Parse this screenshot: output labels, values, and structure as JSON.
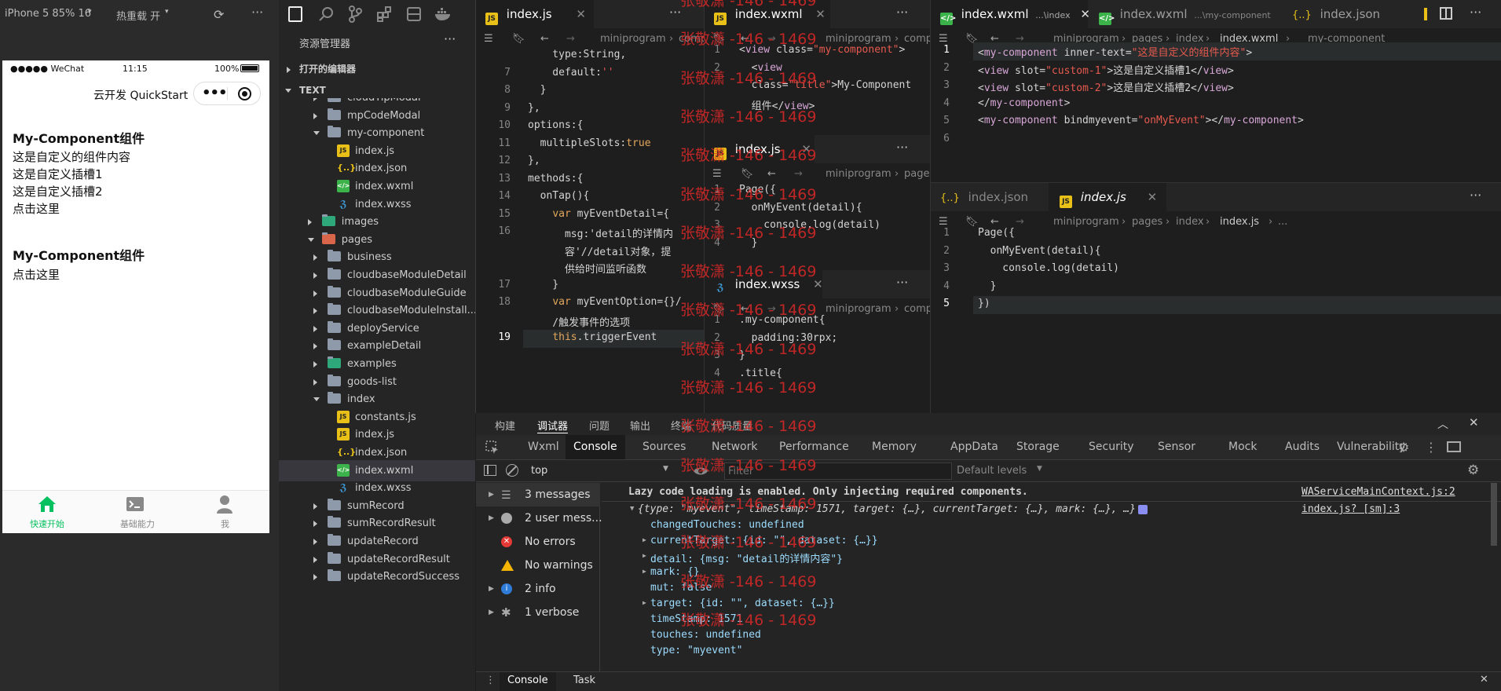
{
  "simulator": {
    "device": "iPhone 5 85% 16",
    "hot_reload": "热重载 开",
    "status_left": "●●●●● WeChat",
    "time": "11:15",
    "battery": "100%",
    "nav_title": "云开发 QuickStart",
    "content": [
      "My-Component组件",
      "这是自定义的组件内容",
      "这是自定义插槽1",
      "这是自定义插槽2",
      "点击这里",
      "My-Component组件",
      "点击这里"
    ],
    "tabbar": [
      "快速开始",
      "基础能力",
      "我"
    ]
  },
  "explorer": {
    "title": "资源管理器",
    "open_editors": "打开的编辑器",
    "root": "TEXT",
    "items": [
      {
        "label": "cloudTipModal",
        "type": "folder"
      },
      {
        "label": "mpCodeModal",
        "type": "folder"
      },
      {
        "label": "my-component",
        "type": "folder-open"
      },
      {
        "label": "index.js",
        "type": "js"
      },
      {
        "label": "index.json",
        "type": "json"
      },
      {
        "label": "index.wxml",
        "type": "wxml"
      },
      {
        "label": "index.wxss",
        "type": "wxss"
      },
      {
        "label": "images",
        "type": "folder"
      },
      {
        "label": "pages",
        "type": "folder-open"
      },
      {
        "label": "business",
        "type": "folder"
      },
      {
        "label": "cloudbaseModuleDetail",
        "type": "folder"
      },
      {
        "label": "cloudbaseModuleGuide",
        "type": "folder"
      },
      {
        "label": "cloudbaseModuleInstall...",
        "type": "folder"
      },
      {
        "label": "deployService",
        "type": "folder"
      },
      {
        "label": "exampleDetail",
        "type": "folder"
      },
      {
        "label": "examples",
        "type": "folder"
      },
      {
        "label": "goods-list",
        "type": "folder"
      },
      {
        "label": "index",
        "type": "folder-open"
      },
      {
        "label": "constants.js",
        "type": "js"
      },
      {
        "label": "index.js",
        "type": "js"
      },
      {
        "label": "index.json",
        "type": "json"
      },
      {
        "label": "index.wxml",
        "type": "wxml"
      },
      {
        "label": "index.wxss",
        "type": "wxss"
      },
      {
        "label": "sumRecord",
        "type": "folder"
      },
      {
        "label": "sumRecordResult",
        "type": "folder"
      },
      {
        "label": "updateRecord",
        "type": "folder"
      },
      {
        "label": "updateRecordResult",
        "type": "folder"
      },
      {
        "label": "updateRecordSuccess",
        "type": "folder"
      }
    ]
  },
  "editor1": {
    "tab": "index.js",
    "breadcrumb": [
      "miniprogram",
      "comp"
    ],
    "lines": [
      {
        "n": "",
        "t": "    type:String,"
      },
      {
        "n": "7",
        "t": "    default:''"
      },
      {
        "n": "8",
        "t": "  }"
      },
      {
        "n": "9",
        "t": "},"
      },
      {
        "n": "10",
        "t": "options:{"
      },
      {
        "n": "11",
        "t": "  multipleSlots:true"
      },
      {
        "n": "12",
        "t": "},"
      },
      {
        "n": "13",
        "t": "methods:{"
      },
      {
        "n": "14",
        "t": "  onTap(){"
      },
      {
        "n": "15",
        "t": "    var myEventDetail={"
      },
      {
        "n": "16",
        "t": "      msg:'detail的详情内"
      },
      {
        "n": "",
        "t": "      容'//detail对象，提"
      },
      {
        "n": "",
        "t": "      供给时间监听函数"
      },
      {
        "n": "17",
        "t": "    }"
      },
      {
        "n": "18",
        "t": "    var myEventOption={}/"
      },
      {
        "n": "",
        "t": "    /触发事件的选项"
      },
      {
        "n": "19",
        "t": "    this.triggerEvent"
      }
    ]
  },
  "editor2": {
    "tab": "index.wxml",
    "breadcrumb": [
      "miniprogram",
      "comp"
    ],
    "lines": [
      {
        "n": "1",
        "t": "<view class=\"my-component\">"
      },
      {
        "n": "2",
        "t": "  <view"
      },
      {
        "n": "",
        "t": "  class=\"title\">My-Component"
      },
      {
        "n": "",
        "t": "  组件</view>"
      }
    ]
  },
  "editor3": {
    "tab": "index.js",
    "breadcrumb": [
      "miniprogram",
      "pages"
    ],
    "lines": [
      {
        "n": "1",
        "t": "Page({"
      },
      {
        "n": "2",
        "t": "  onMyEvent(detail){"
      },
      {
        "n": "3",
        "t": "    console.log(detail)"
      },
      {
        "n": "4",
        "t": "  }"
      }
    ]
  },
  "editor4": {
    "tab": "index.wxss",
    "breadcrumb": [
      "miniprogram",
      "comp"
    ],
    "lines": [
      {
        "n": "1",
        "t": ".my-component{"
      },
      {
        "n": "2",
        "t": "  padding:30rpx;"
      },
      {
        "n": "3",
        "t": "}"
      },
      {
        "n": "4",
        "t": ".title{"
      }
    ]
  },
  "editor5": {
    "tabs": [
      "index.wxml",
      "...\\index",
      "index.wxml",
      "...\\my-component",
      "index.json"
    ],
    "breadcrumb": [
      "miniprogram",
      "pages",
      "index",
      "index.wxml",
      "my-component"
    ],
    "lines": [
      {
        "n": "1",
        "t": "<my-component inner-text=\"这是自定义的组件内容\">"
      },
      {
        "n": "2",
        "t": "<view slot=\"custom-1\">这是自定义插槽1</view>"
      },
      {
        "n": "3",
        "t": "<view slot=\"custom-2\">这是自定义插槽2</view>"
      },
      {
        "n": "4",
        "t": "</my-component>"
      },
      {
        "n": "5",
        "t": "<my-component bindmyevent=\"onMyEvent\"></my-component>"
      },
      {
        "n": "6",
        "t": ""
      }
    ]
  },
  "editor6": {
    "tabs": [
      "index.json",
      "index.js"
    ],
    "breadcrumb": [
      "miniprogram",
      "pages",
      "index",
      "index.js",
      "..."
    ],
    "lines": [
      {
        "n": "1",
        "t": "Page({"
      },
      {
        "n": "2",
        "t": "  onMyEvent(detail){"
      },
      {
        "n": "3",
        "t": "    console.log(detail)"
      },
      {
        "n": "4",
        "t": "  }"
      },
      {
        "n": "5",
        "t": "})"
      }
    ]
  },
  "devtools": {
    "top_tabs": [
      "构建",
      "调试器",
      "问题",
      "输出",
      "终端",
      "代码质量"
    ],
    "tabs": [
      "Wxml",
      "Console",
      "Sources",
      "Network",
      "Performance",
      "Memory",
      "AppData",
      "Storage",
      "Security",
      "Sensor",
      "Mock",
      "Audits",
      "Vulnerability"
    ],
    "context": "top",
    "filter_placeholder": "Filter",
    "levels": "Default levels",
    "sidebar": [
      "3 messages",
      "2 user mess...",
      "No errors",
      "No warnings",
      "2 info",
      "1 verbose"
    ],
    "log_lines": [
      "Lazy code loading is enabled. Only injecting required components.",
      "{type: \"myevent\", timeStamp: 1571, target: {…}, currentTarget: {…}, mark: {…}, …}",
      "changedTouches: undefined",
      "currentTarget: {id: \"\", dataset: {…}}",
      "detail: {msg: \"detail的详情内容\"}",
      "mark: {}",
      "mut: false",
      "target: {id: \"\", dataset: {…}}",
      "timeStamp: 1571",
      "touches: undefined",
      "type: \"myevent\""
    ],
    "sources": [
      "WAServiceMainContext.js:2",
      "index.js? [sm]:3"
    ],
    "bottom_tabs": [
      "Console",
      "Task"
    ]
  },
  "watermark": "张敬潇 -146 - 1469",
  "colors": {
    "accent": "#07c160",
    "selection": "#0e639c",
    "watermark": "#dc2828"
  }
}
